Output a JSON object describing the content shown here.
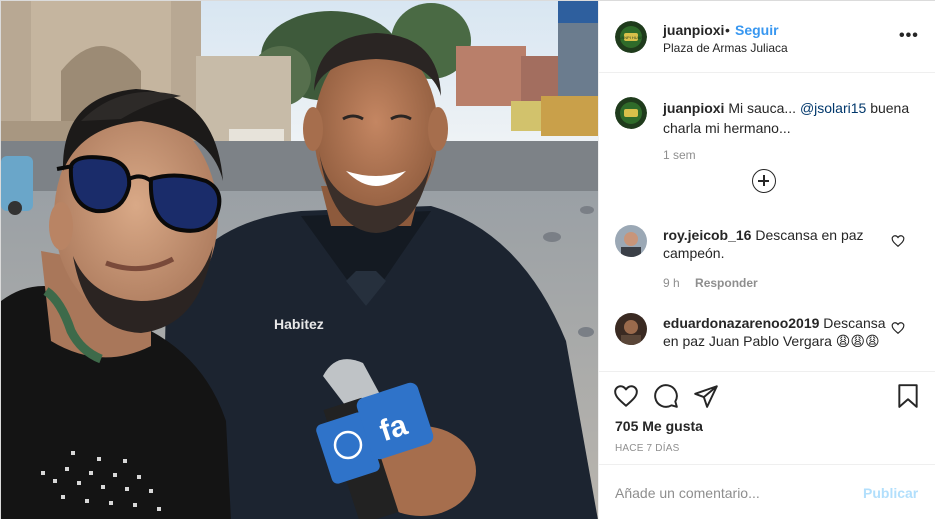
{
  "post": {
    "author": "juanpioxi",
    "follow_label": "Seguir",
    "separator": "•",
    "location": "Plaza de Armas Juliaca",
    "avatar_text": "JUANPI HUAPA",
    "more_icon": "more-horizontal-icon"
  },
  "photo": {
    "jacket_brand": "Habitez",
    "mic_flag_text": "fa"
  },
  "caption": {
    "author": "juanpioxi",
    "text_before": "Mi sauca...",
    "mention": "@jsolari15",
    "text_after": "buena charla mi hermano...",
    "time": "1 sem"
  },
  "comments": [
    {
      "author": "roy.jeicob_16",
      "text": "Descansa en paz campeón.",
      "time": "9 h",
      "reply_label": "Responder"
    },
    {
      "author": "eduardonazarenoo2019",
      "text": "Descansa en paz Juan Pablo Vergara 😩😩😩"
    }
  ],
  "actions": {
    "likes": "705 Me gusta",
    "ago": "HACE 7 DÍAS",
    "icons": [
      "heart-icon",
      "comment-icon",
      "share-icon",
      "bookmark-icon"
    ]
  },
  "add_comment": {
    "placeholder": "Añade un comentario...",
    "publish_label": "Publicar"
  },
  "colors": {
    "link_blue": "#3897f0",
    "publish_disabled": "#b2dffc",
    "muted": "#8e8e8e",
    "divider": "#efefef"
  }
}
